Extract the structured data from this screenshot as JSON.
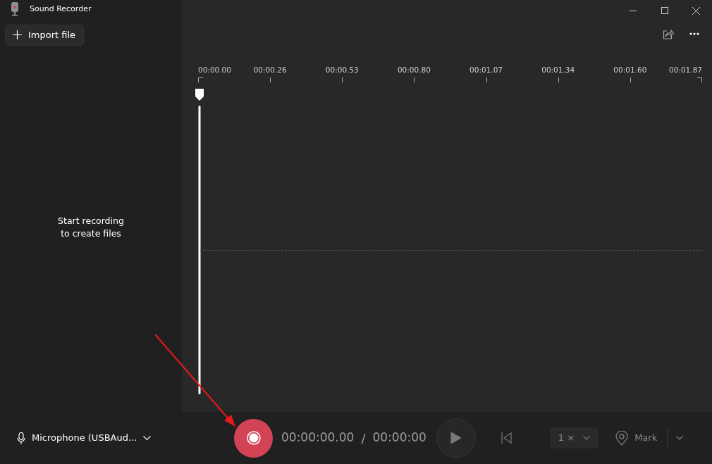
{
  "window": {
    "title": "Sound Recorder"
  },
  "sidebar": {
    "import_button": "Import file",
    "empty_message": "Start recording\nto create files"
  },
  "timeline": {
    "ticks": [
      "00:00.00",
      "00:00.26",
      "00:00.53",
      "00:00.80",
      "00:01.07",
      "00:01.34",
      "00:01.60",
      "00:01.87"
    ]
  },
  "bottom_bar": {
    "microphone": "Microphone (USBAud...",
    "time_elapsed": "00:00:00.00",
    "separator": "/",
    "time_total": "00:00:00",
    "play": {
      "disabled": true
    },
    "skip_back": {
      "disabled": true
    },
    "speed": {
      "label": "1 ×",
      "disabled": true
    },
    "mark": {
      "label": "Mark",
      "disabled": true
    }
  }
}
